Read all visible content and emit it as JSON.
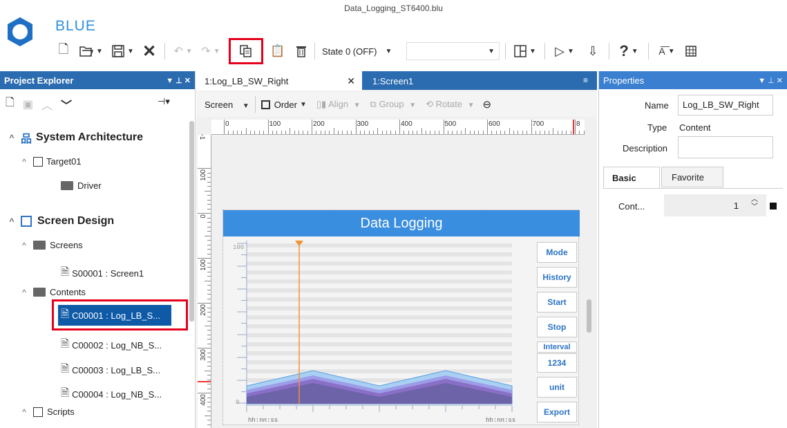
{
  "window": {
    "title": "Data_Logging_ST6400.blu",
    "app_name": "BLUE"
  },
  "toolbar": {
    "state_value": "State 0 (OFF)",
    "dropdown_arrow": "▼"
  },
  "project_explorer": {
    "title": "Project Explorer",
    "system_architecture": "System Architecture",
    "target": "Target01",
    "driver": "Driver",
    "screen_design": "Screen Design",
    "screens": "Screens",
    "screen1": "S00001 : Screen1",
    "contents": "Contents",
    "items": [
      "C00001 : Log_LB_S...",
      "C00002 : Log_NB_S...",
      "C00003 : Log_LB_S...",
      "C00004 : Log_NB_S..."
    ],
    "scripts": "Scripts"
  },
  "editor": {
    "tabs": [
      {
        "label": "1:Log_LB_SW_Right"
      },
      {
        "label": "1:Screen1"
      }
    ],
    "screen_label": "Screen",
    "order_label": "Order",
    "align_label": "Align",
    "group_label": "Group",
    "rotate_label": "Rotate",
    "ruler_h": [
      "0",
      "100",
      "200",
      "300",
      "400",
      "500",
      "600",
      "700",
      "8"
    ],
    "ruler_v": [
      "100",
      "0",
      "100",
      "200",
      "300",
      "400"
    ],
    "ruler_top_marker": "-1"
  },
  "widget": {
    "title": "Data Logging",
    "y_max": "100",
    "y_min": "0",
    "x_left": "hh:nn:ss",
    "x_right": "hh:nn:ss",
    "buttons": {
      "mode": "Mode",
      "history": "History",
      "start": "Start",
      "stop": "Stop",
      "interval": "Interval",
      "interval_value": "1234",
      "unit": "unit",
      "export": "Export"
    },
    "colors": {
      "header": "#3a8ee0",
      "series1": "#a9cff2",
      "series2": "#9c9ce8",
      "series3": "#8a6fc6",
      "series4": "#6d63a8",
      "cursor": "#f39233"
    }
  },
  "properties": {
    "title": "Properties",
    "name_label": "Name",
    "name_value": "Log_LB_SW_Right",
    "type_label": "Type",
    "type_value": "Content",
    "description_label": "Description",
    "description_value": "",
    "tabs": [
      "Basic",
      "Favorite"
    ],
    "cont_label": "Cont...",
    "cont_value": "1"
  }
}
